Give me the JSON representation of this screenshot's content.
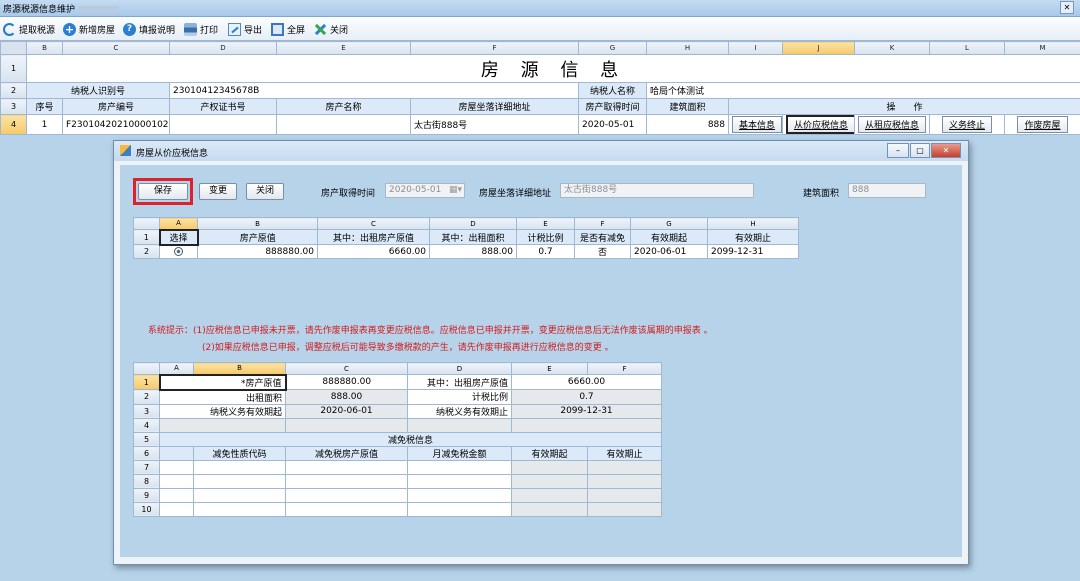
{
  "window": {
    "title": "房源税源信息维护",
    "close_glyph": "✕"
  },
  "toolbar": [
    {
      "name": "fetch-tax-source-button",
      "label": "提取税源",
      "icon": "refresh-icon"
    },
    {
      "name": "add-property-button",
      "label": "新增房屋",
      "icon": "plus-icon"
    },
    {
      "name": "fill-instructions-button",
      "label": "填报说明",
      "icon": "help-icon"
    },
    {
      "name": "print-button",
      "label": "打印",
      "icon": "printer-icon"
    },
    {
      "name": "export-button",
      "label": "导出",
      "icon": "export-icon"
    },
    {
      "name": "fullscreen-button",
      "label": "全屏",
      "icon": "fullscreen-icon"
    },
    {
      "name": "close-button",
      "label": "关闭",
      "icon": "close-icon"
    }
  ],
  "sheet": {
    "columns": [
      "",
      "B",
      "C",
      "D",
      "E",
      "F",
      "G",
      "H",
      "I",
      "J",
      "K",
      "L",
      "M"
    ],
    "title": "房 源 信 息",
    "row2": {
      "taxpayer_id_label": "纳税人识别号",
      "taxpayer_id_value": "23010412345678B",
      "taxpayer_name_label": "纳税人名称",
      "taxpayer_name_value": "哈局个体测试"
    },
    "headers": [
      "序号",
      "房产编号",
      "产权证书号",
      "房产名称",
      "房屋坐落详细地址",
      "房产取得时间",
      "建筑面积",
      "操　　作"
    ],
    "row4": {
      "seq": "1",
      "property_no": "F23010420210000102",
      "certificate_no": "",
      "property_name": "",
      "address": "太古街888号",
      "acquired_date": "2020-05-01",
      "area": "888"
    },
    "actions": [
      "基本信息",
      "从价应税信息",
      "从租应税信息",
      "义务终止",
      "作废房屋"
    ],
    "row_numbers": [
      "1",
      "2",
      "3",
      "4"
    ]
  },
  "dialog": {
    "title": "房屋从价应税信息",
    "buttons": {
      "save": "保存",
      "change": "变更",
      "close": "关闭"
    },
    "acquired_time_label": "房产取得时间",
    "acquired_time_value": "2020-05-01",
    "address_label": "房屋坐落详细地址",
    "address_value": "太古街888号",
    "area_label": "建筑面积",
    "area_value": "888",
    "upper_grid": {
      "columns": [
        "",
        "A",
        "B",
        "C",
        "D",
        "E",
        "F",
        "G",
        "H"
      ],
      "headers": [
        "选择",
        "房产原值",
        "其中：出租房产原值",
        "其中：出租面积",
        "计税比例",
        "是否有减免",
        "有效期起",
        "有效期止"
      ],
      "row": [
        "",
        "888880.00",
        "6660.00",
        "888.00",
        "0.7",
        "否",
        "2020-06-01",
        "2099-12-31"
      ],
      "row_numbers": [
        "1",
        "2"
      ]
    },
    "hints": {
      "line1": "系统提示：(1)应税信息已申报未开票，请先作废申报表再变更应税信息。应税信息已申报并开票，变更应税信息后无法作废该属期的申报表 。",
      "line2": "(2)如果应税信息已申报，调整应税后可能导致多缴税款的产生，请先作废申报再进行应税信息的变更 。"
    },
    "lower_grid": {
      "columns": [
        "",
        "A",
        "B",
        "C",
        "D",
        "E",
        "F"
      ],
      "original_value_label": "*房产原值",
      "original_value": "888880.00",
      "rented_value_label": "其中：出租房产原值",
      "rented_value": "6660.00",
      "rented_area_label": "出租面积",
      "rented_area": "888.00",
      "tax_ratio_label": "计税比例",
      "tax_ratio": "0.7",
      "start_label": "纳税义务有效期起",
      "start_value": "2020-06-01",
      "end_label": "纳税义务有效期止",
      "end_value": "2099-12-31",
      "relief_title": "减免税信息",
      "relief_headers": [
        "减免性质代码",
        "减免税房产原值",
        "月减免税金额",
        "有效期起",
        "有效期止"
      ],
      "row_numbers": [
        "1",
        "2",
        "3",
        "4",
        "5",
        "6",
        "7",
        "8",
        "9",
        "10"
      ]
    }
  },
  "colors": {
    "highlight_border": "#e0202a",
    "hint_text": "#d21b1b",
    "background": "#b7d3ea"
  }
}
